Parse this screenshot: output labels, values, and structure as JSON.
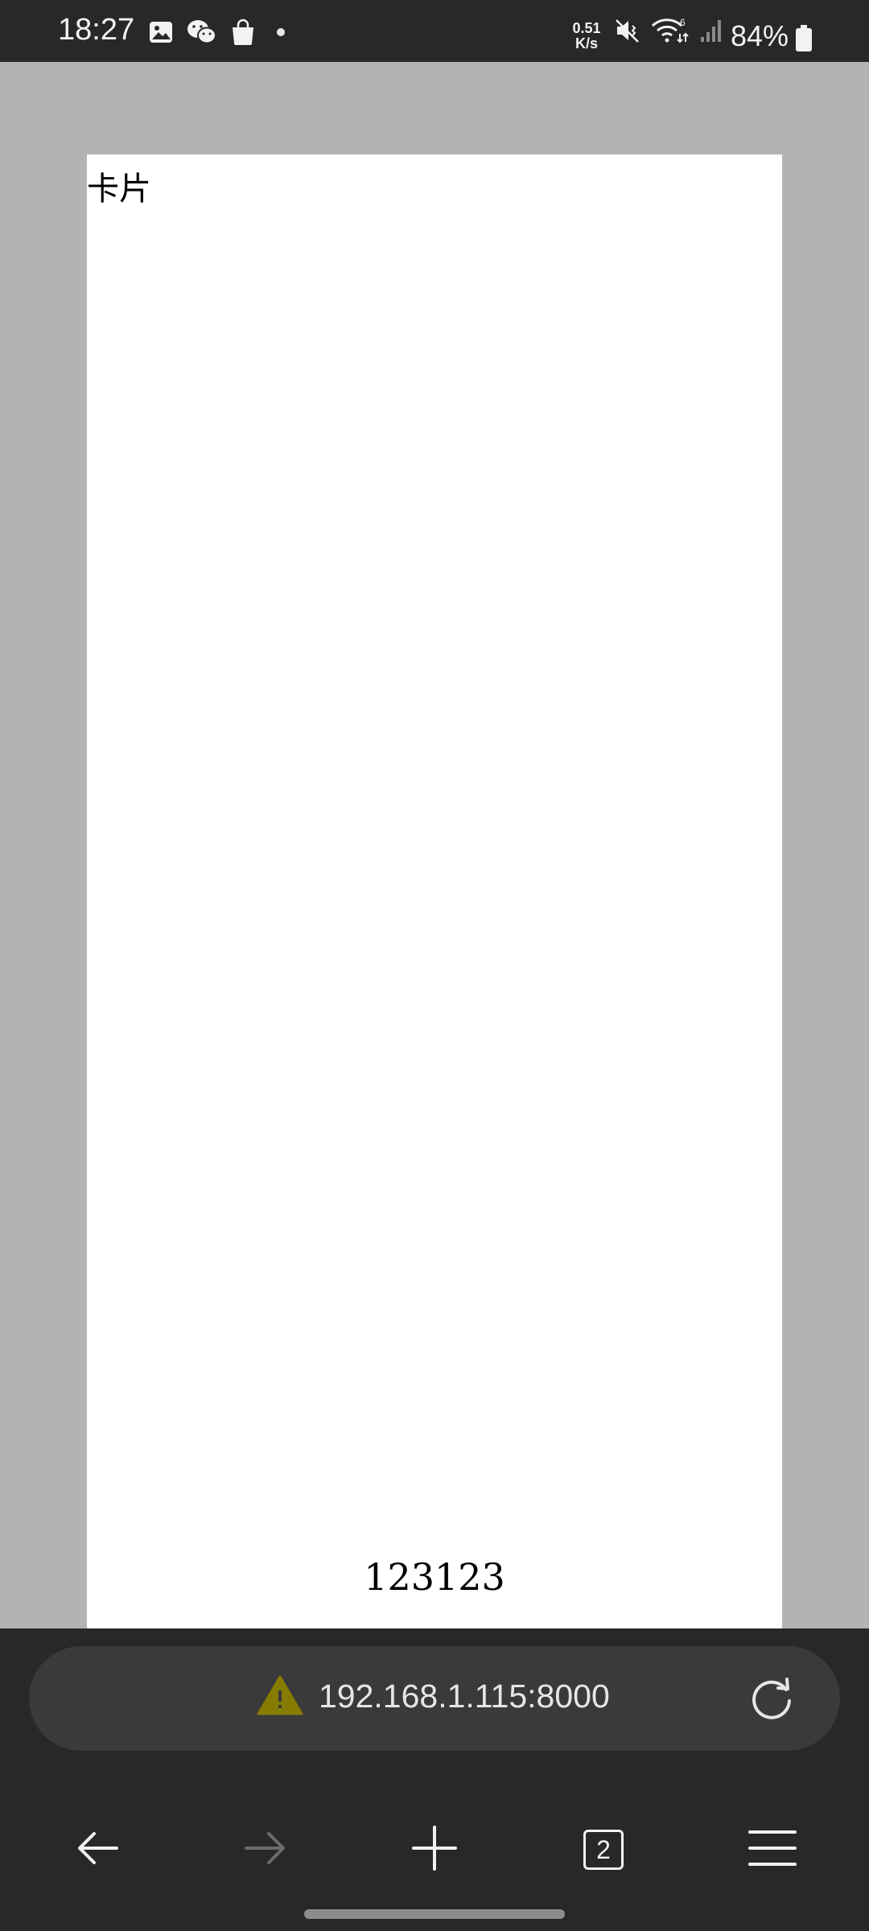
{
  "status_bar": {
    "time": "18:27",
    "notification_icons": [
      "gallery-icon",
      "wechat-icon",
      "shopping-bag-icon"
    ],
    "net_speed_value": "0.51",
    "net_speed_unit": "K/s",
    "system_icons": [
      "mute-icon",
      "wifi-6-icon",
      "cellular-signal-icon"
    ],
    "battery_percent": "84%"
  },
  "page": {
    "card_title": "卡片",
    "card_footer_text": "123123"
  },
  "browser": {
    "url": "192.168.1.115:8000",
    "security_icon": "warning-icon",
    "tab_count": "2",
    "toolbar_icons": [
      "back-arrow-icon",
      "forward-arrow-icon",
      "plus-icon",
      "tabs-icon",
      "menu-icon"
    ]
  },
  "colors": {
    "status_bar_bg": "#282828",
    "page_bg": "#b3b3b3",
    "card_bg": "#ffffff",
    "url_bar_bg": "#3a3a3a",
    "warning_color": "#857b00"
  }
}
